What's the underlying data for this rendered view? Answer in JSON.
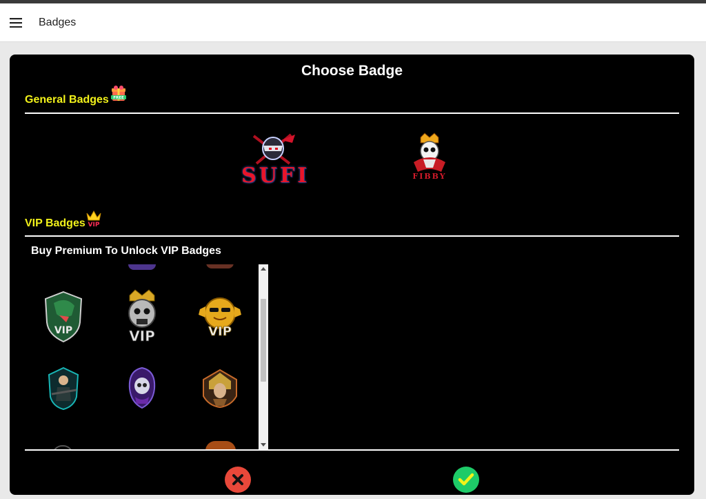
{
  "appbar": {
    "title": "Badges",
    "menu_icon": "hamburger-menu-icon"
  },
  "dialog": {
    "title": "Choose Badge",
    "general": {
      "title": "General Badges",
      "free_tag": "FREE",
      "badges": [
        {
          "name": "SUFI",
          "icon": "ninja-mascot-icon"
        },
        {
          "name": "FIBBY",
          "icon": "crowned-skull-mascot-icon"
        }
      ]
    },
    "vip": {
      "title": "VIP Badges",
      "tag": "VIP",
      "note": "Buy Premium To Unlock VIP Badges",
      "badges": [
        {
          "icon": "dinosaur-vip-icon",
          "label": "VIP"
        },
        {
          "icon": "crowned-skull-vip-icon",
          "label": "VIP"
        },
        {
          "icon": "sun-vip-icon",
          "label": "VIP"
        },
        {
          "icon": "gunner-mascot-icon",
          "label": ""
        },
        {
          "icon": "hooded-skull-icon",
          "label": ""
        },
        {
          "icon": "pharaoh-mascot-icon",
          "label": ""
        }
      ]
    },
    "actions": {
      "cancel_icon": "close-icon",
      "confirm_icon": "check-icon"
    }
  },
  "colors": {
    "accent": "#f2f21a",
    "cancel": "#e8483a",
    "confirm": "#1ecb68",
    "vip_tag": "#ff2d55"
  }
}
